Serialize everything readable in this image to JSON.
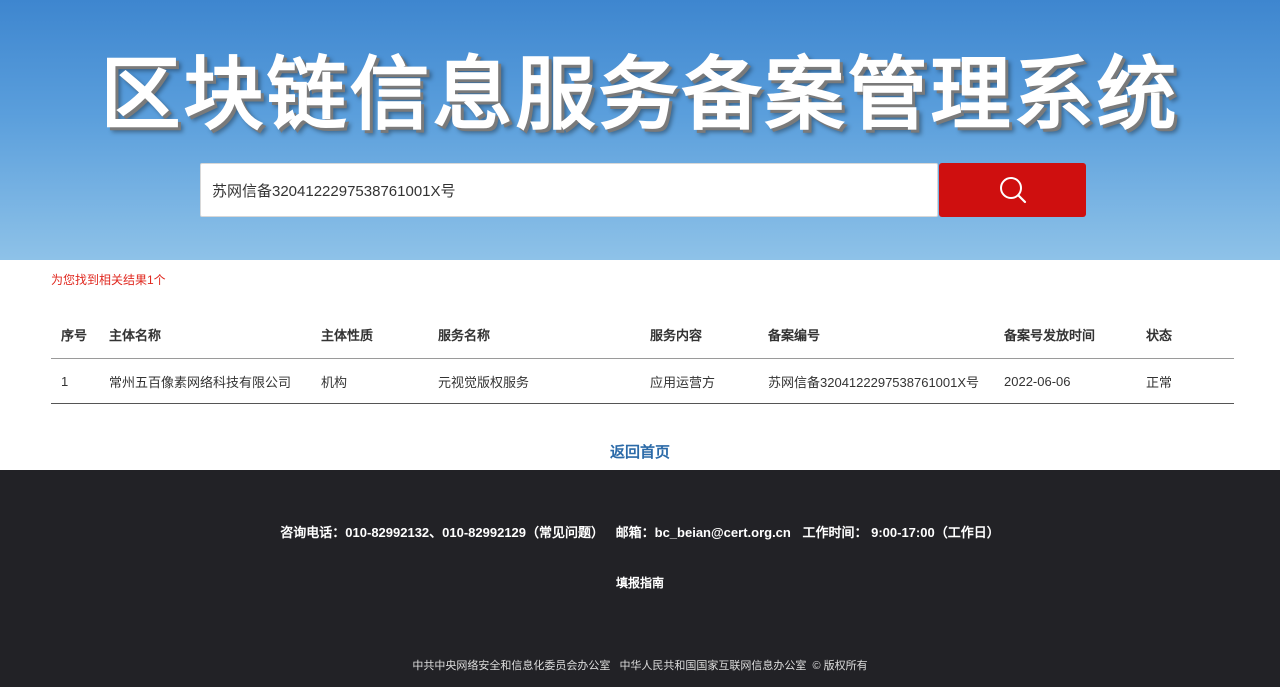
{
  "header": {
    "title": "区块链信息服务备案管理系统"
  },
  "search": {
    "value": "苏网信备32041222975387610​01X号",
    "button_icon": "search-icon"
  },
  "results": {
    "summary": "为您找到相关结果1个",
    "columns": [
      "序号",
      "主体名称",
      "主体性质",
      "服务名称",
      "服务内容",
      "备案编号",
      "备案号发放时间",
      "状态"
    ],
    "rows": [
      [
        "1",
        "常州五百像素网络科技有限公司",
        "机构",
        "元视觉版权服务",
        "应用运营方",
        "苏网信备32041222975387610​01X号",
        "2022-06-06",
        "正常"
      ]
    ]
  },
  "back_link": "返回首页",
  "footer": {
    "phone": "咨询电话：010-82992132、010-82992129（常见问题）",
    "email": "邮箱：bc_beian@cert.org.cn",
    "hours": "工作时间： 9:00-17:00（工作日）",
    "guide": "填报指南",
    "org1": "中共中央网络安全和信息化委员会办公室",
    "org2": "中华人民共和国国家互联网信息办公室",
    "rights": "© 版权所有"
  },
  "colors": {
    "accent_red": "#cf0f0f",
    "link_blue": "#2b6aa8",
    "footer_bg": "#222226",
    "hero_blue": "#3e86cf"
  }
}
